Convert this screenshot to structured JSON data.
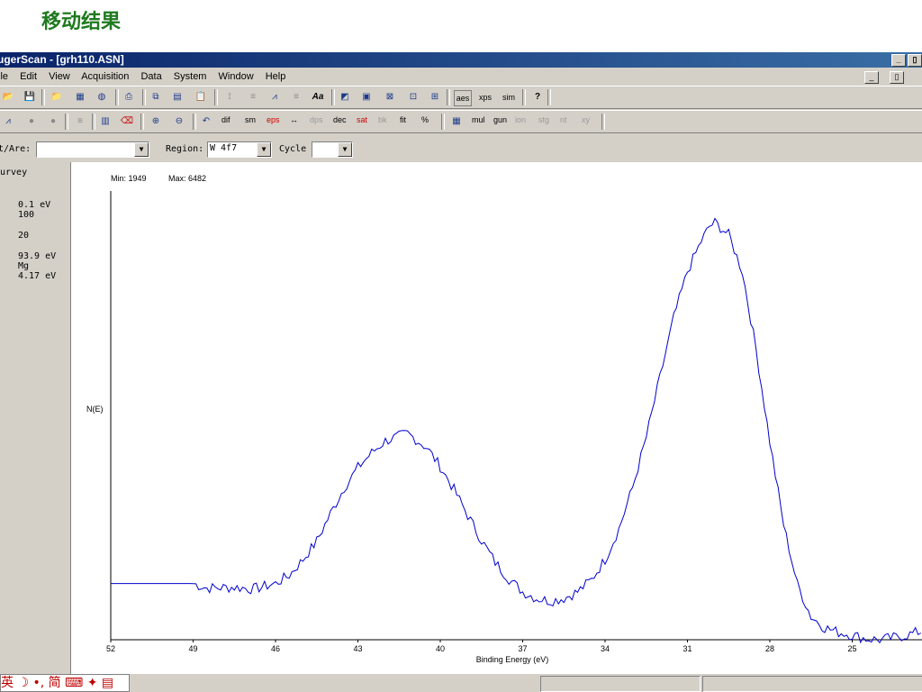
{
  "slide_title": "移动结果",
  "window": {
    "title": "ugerScan - [grh110.ASN]",
    "min_icon": "minimize-icon",
    "restore_icon": "restore-icon"
  },
  "menu": [
    "ile",
    "Edit",
    "View",
    "Acquisition",
    "Data",
    "System",
    "Window",
    "Help"
  ],
  "toolbar1": [
    "open-icon",
    "save-icon",
    "folder-icon",
    "copy-icon",
    "paste-icon",
    "print-icon",
    "copy2-icon",
    "pagecopy-icon",
    "clipboard-icon",
    "fit-icon",
    "fit2-icon",
    "peak-icon",
    "label-icon",
    "font-icon",
    "chart1-icon",
    "chart2-icon",
    "chart3-icon",
    "chart4-icon",
    "chart5-icon",
    "aes-icon",
    "xps-icon",
    "sim-icon",
    "help-icon"
  ],
  "toolbar1_text": {
    "font": "Aa",
    "aes": "aes",
    "xps": "xps",
    "sim": "sim",
    "help": "?"
  },
  "toolbar2_text": [
    "dif",
    "sm",
    "eps",
    "↔",
    "dps",
    "dec",
    "sat",
    "bk",
    "fit",
    "%",
    "mul",
    "gun",
    "ion",
    "stg",
    "nt",
    "xy"
  ],
  "selection": {
    "point_label": "t/Are:",
    "point_value": "",
    "region_label": "Region:",
    "region_value": "W 4f7",
    "cycle_label": "Cycle",
    "cycle_value": ""
  },
  "left_panel": {
    "survey": "urvey",
    "step": "0.1 eV",
    "n1": "100",
    "n2": "20",
    "pass": "93.9 eV",
    "source": "Mg",
    "wf": "4.17 eV"
  },
  "ime": {
    "text": "英 ☽ •, 简 ⌨ ✦ ▤"
  },
  "chart_data": {
    "type": "line",
    "min_label": "Min: 1949",
    "max_label": "Max: 6482",
    "ylabel": "N(E)",
    "xlabel": "Binding Energy (eV)",
    "x_ticks": [
      "52",
      "49",
      "46",
      "43",
      "40",
      "37",
      "34",
      "31",
      "28",
      "25"
    ],
    "xlim": [
      52,
      22
    ],
    "ylim": [
      1949,
      6482
    ],
    "series": [
      {
        "color": "#0000cc",
        "x": [
          52,
          49,
          48.5,
          47.5,
          46.8,
          46,
          45.5,
          45,
          44.5,
          44,
          43.5,
          43,
          42.5,
          42,
          41.5,
          41.2,
          41,
          40.5,
          40,
          39.5,
          39,
          38.5,
          38,
          37.5,
          37,
          36.5,
          36,
          35.5,
          35,
          34.5,
          34,
          33.5,
          33,
          32.5,
          32,
          31.5,
          31,
          30.5,
          30.2,
          30,
          29.5,
          29,
          28.5,
          28,
          27.5,
          27,
          26.5,
          26,
          25.5,
          25,
          24.5,
          24,
          23.5,
          23,
          22.5,
          22
        ],
        "y": [
          2560,
          2560,
          2510,
          2520,
          2500,
          2560,
          2650,
          2820,
          3020,
          3320,
          3600,
          3820,
          3980,
          4110,
          4160,
          4190,
          4150,
          4040,
          3830,
          3580,
          3300,
          3030,
          2790,
          2610,
          2470,
          2400,
          2370,
          2400,
          2470,
          2600,
          2820,
          3150,
          3600,
          4150,
          4800,
          5450,
          5950,
          6280,
          6440,
          6482,
          6350,
          5950,
          5100,
          4100,
          3200,
          2550,
          2200,
          2080,
          2030,
          2000,
          1960,
          1949,
          1970,
          2000,
          2040,
          2080
        ]
      }
    ]
  }
}
